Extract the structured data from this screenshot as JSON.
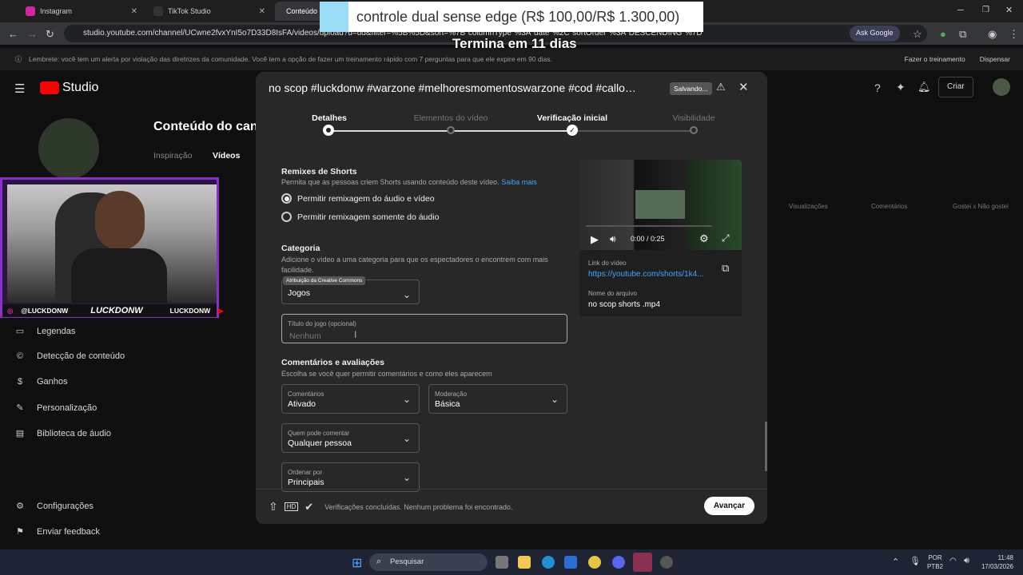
{
  "browser": {
    "tabs": [
      {
        "title": "Instagram",
        "color": "#d6249f"
      },
      {
        "title": "TikTok Studio",
        "color": "#111111"
      },
      {
        "title": "Conteúdo",
        "color": "#ff0000"
      }
    ],
    "url": "studio.youtube.com/channel/UCwne2fvxYnI5o7D33D8IsFA/videos/upload?d=ud&filter=%5B%5D&sort=%7B\"columnType\"%3A\"date\"%2C\"sortOrder\"%3A\"DESCENDING\"%7D",
    "ask_google": "Ask Google"
  },
  "overlay": {
    "title": "controle dual sense edge (R$ 100,00/R$ 1.300,00)",
    "timer": "Termina em 11 dias"
  },
  "warning": {
    "text": "Lembrete: você tem um alerta por violação das diretrizes da comunidade. Você tem a opção de fazer um treinamento rápido com 7 perguntas para que ele expire em 90 dias.",
    "train": "Fazer o treinamento",
    "dismiss": "Dispensar"
  },
  "studio": {
    "logo": "Studio",
    "create": "Criar",
    "page_title": "Conteúdo do canal",
    "tabs": [
      "Inspiração",
      "Vídeos"
    ],
    "columns": [
      "Visualizações",
      "Comentários",
      "Gostei x Não gostei"
    ],
    "nav": [
      "Legendas",
      "Detecção de conteúdo",
      "Ganhos",
      "Personalização",
      "Biblioteca de áudio"
    ],
    "nav_bottom": [
      "Configurações",
      "Enviar feedback"
    ]
  },
  "webcam": {
    "handle": "@LUCKDONW",
    "name": "LUCKDONW",
    "yt": "LUCKDONW"
  },
  "modal": {
    "title": "no scop #luckdonw #warzone #melhoresmomentoswarzone #cod #callof...",
    "saving": "Salvando...",
    "steps": [
      "Detalhes",
      "Elementos do vídeo",
      "Verificação inicial",
      "Visibilidade"
    ],
    "remix": {
      "heading": "Remixes de Shorts",
      "desc": "Permita que as pessoas criem Shorts usando conteúdo deste vídeo.",
      "link": "Saiba mais",
      "opt1": "Permitir remixagem do áudio e vídeo",
      "opt2": "Permitir remixagem somente do áudio"
    },
    "category": {
      "heading": "Categoria",
      "desc": "Adicione o vídeo a uma categoria para que os espectadores o encontrem com mais facilidade.",
      "tooltip": "Atribuição da Creative Commons",
      "value": "Jogos",
      "game_label": "Título do jogo (opcional)",
      "game_placeholder": "Nenhum"
    },
    "comments": {
      "heading": "Comentários e avaliações",
      "desc": "Escolha se você quer permitir comentários e como eles aparecem",
      "comments_label": "Comentários",
      "comments_value": "Ativado",
      "moderation_label": "Moderação",
      "moderation_value": "Básica",
      "who_label": "Quem pode comentar",
      "who_value": "Qualquer pessoa",
      "order_label": "Ordenar por",
      "order_value": "Principais"
    },
    "preview": {
      "time": "0:00 / 0:25",
      "link_label": "Link do vídeo",
      "link": "https://youtube.com/shorts/1k4...",
      "file_label": "Nome do arquivo",
      "file": "no scop shorts .mp4"
    },
    "footer": {
      "status": "Verificações concluídas. Nenhum problema foi encontrado.",
      "next": "Avançar"
    }
  },
  "taskbar": {
    "search": "Pesquisar",
    "lang": "POR",
    "layout": "PTB2",
    "time": "11:48",
    "date": "17/03/2026"
  }
}
